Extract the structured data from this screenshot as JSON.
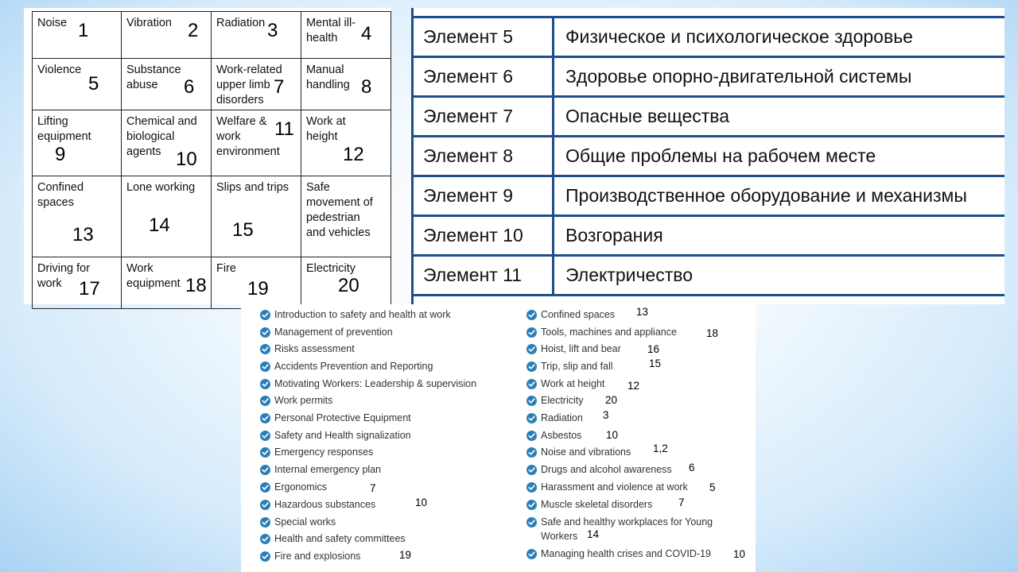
{
  "hazard_grid": {
    "rows": [
      [
        {
          "label": "Noise",
          "num": "1"
        },
        {
          "label": "Vibration",
          "num": "2"
        },
        {
          "label": "Radiation",
          "num": "3"
        },
        {
          "label": "Mental ill-\nhealth",
          "num": "4"
        }
      ],
      [
        {
          "label": "Violence",
          "num": "5"
        },
        {
          "label": "Substance\nabuse",
          "num": "6"
        },
        {
          "label": "Work-related\nupper limb\ndisorders",
          "num": "7"
        },
        {
          "label": "Manual\nhandling",
          "num": "8"
        }
      ],
      [
        {
          "label": "Lifting\nequipment",
          "num": "9"
        },
        {
          "label": "Chemical and\nbiological\nagents",
          "num": "10"
        },
        {
          "label": "Welfare &\nwork\nenvironment",
          "num": "11"
        },
        {
          "label": "Work at\nheight",
          "num": "12"
        }
      ],
      [
        {
          "label": "Confined\nspaces",
          "num": "13"
        },
        {
          "label": "Lone working",
          "num": "14"
        },
        {
          "label": "Slips and trips",
          "num": "15"
        },
        {
          "label": "Safe\nmovement of\npedestrian\nand vehicles",
          "num": ""
        }
      ],
      [
        {
          "label": "Driving for\nwork",
          "num": "17"
        },
        {
          "label": "Work\nequipment",
          "num": "18"
        },
        {
          "label": "Fire",
          "num": "19"
        },
        {
          "label": "Electricity",
          "num": "20"
        }
      ]
    ]
  },
  "elements_table": [
    {
      "element": "Элемент 5",
      "description": "Физическое и психологическое здоровье"
    },
    {
      "element": "Элемент 6",
      "description": "Здоровье опорно-двигательной системы"
    },
    {
      "element": "Элемент 7",
      "description": "Опасные вещества"
    },
    {
      "element": "Элемент 8",
      "description": "Общие проблемы на рабочем месте"
    },
    {
      "element": "Элемент 9",
      "description": "Производственное оборудование и механизмы"
    },
    {
      "element": "Элемент 10",
      "description": "Возгорания"
    },
    {
      "element": "Элемент 11",
      "description": "Электричество"
    }
  ],
  "checklist": {
    "left": [
      {
        "text": "Introduction to safety and health at work",
        "num": ""
      },
      {
        "text": "Management of prevention",
        "num": ""
      },
      {
        "text": "Risks assessment",
        "num": ""
      },
      {
        "text": "Accidents Prevention and Reporting",
        "num": ""
      },
      {
        "text": "Motivating Workers: Leadership & supervision",
        "num": ""
      },
      {
        "text": "Work permits",
        "num": ""
      },
      {
        "text": "Personal Protective Equipment",
        "num": ""
      },
      {
        "text": "Safety and Health signalization",
        "num": ""
      },
      {
        "text": "Emergency responses",
        "num": ""
      },
      {
        "text": "Internal emergency plan",
        "num": ""
      },
      {
        "text": "Ergonomics",
        "num": "7"
      },
      {
        "text": "Hazardous substances",
        "num": "10"
      },
      {
        "text": "Special works",
        "num": ""
      },
      {
        "text": "Health and safety committees",
        "num": ""
      },
      {
        "text": "Fire and explosions",
        "num": "19"
      }
    ],
    "right": [
      {
        "text": "Confined spaces",
        "num": "13"
      },
      {
        "text": "Tools, machines and appliance",
        "num": "18"
      },
      {
        "text": "Hoist, lift and bear",
        "num": "16"
      },
      {
        "text": "Trip, slip and fall",
        "num": "15"
      },
      {
        "text": "Work at height",
        "num": "12"
      },
      {
        "text": "Electricity",
        "num": "20"
      },
      {
        "text": "Radiation",
        "num": "3"
      },
      {
        "text": "Asbestos",
        "num": "10"
      },
      {
        "text": "Noise and vibrations",
        "num": "1,2"
      },
      {
        "text": "Drugs and alcohol awareness",
        "num": "6"
      },
      {
        "text": "Harassment and violence at work",
        "num": "5"
      },
      {
        "text": "Muscle skeletal disorders",
        "num": "7"
      },
      {
        "text": "Safe and healthy workplaces for Young",
        "text2": "Workers",
        "num": "14"
      },
      {
        "text": "Managing health crises and COVID-19",
        "num": "10"
      }
    ]
  },
  "colors": {
    "check_icon": "#2a7fb8",
    "table_border": "#1f4e8c"
  }
}
